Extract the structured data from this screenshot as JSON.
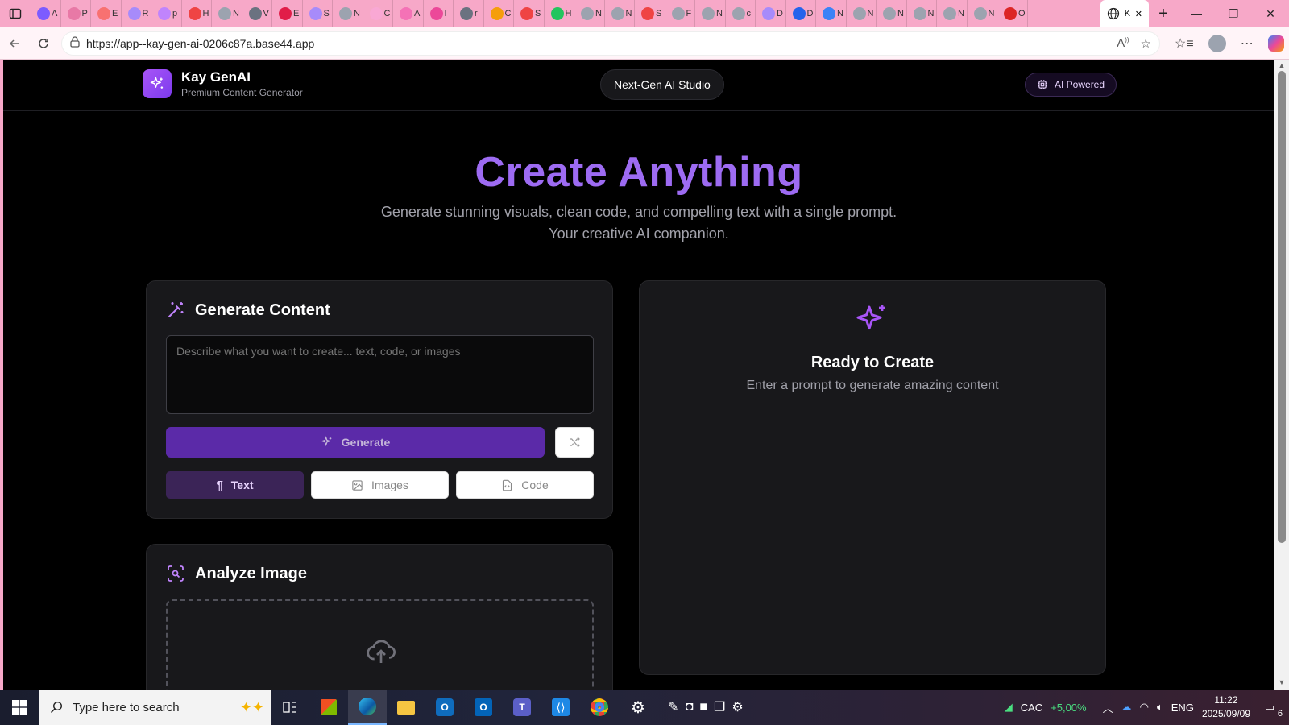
{
  "browser": {
    "url": "https://app--kay-gen-ai-0206c87a.base44.app",
    "tabs": [
      {
        "label": "A",
        "color": "#7c5cff"
      },
      {
        "label": "P",
        "color": "#e879a6"
      },
      {
        "label": "E",
        "color": "#f87171"
      },
      {
        "label": "R",
        "color": "#a78bfa"
      },
      {
        "label": "p",
        "color": "#c084fc"
      },
      {
        "label": "H",
        "color": "#ef4444"
      },
      {
        "label": "N",
        "color": "#9ca3af"
      },
      {
        "label": "V",
        "color": "#6b7280"
      },
      {
        "label": "E",
        "color": "#e11d48"
      },
      {
        "label": "S",
        "color": "#a78bfa"
      },
      {
        "label": "N",
        "color": "#9ca3af"
      },
      {
        "label": "C",
        "color": "#f9a8d4"
      },
      {
        "label": "A",
        "color": "#f472b6"
      },
      {
        "label": "I",
        "color": "#ec4899"
      },
      {
        "label": "r",
        "color": "#6b7280"
      },
      {
        "label": "C",
        "color": "#f59e0b"
      },
      {
        "label": "S",
        "color": "#ef4444"
      },
      {
        "label": "H",
        "color": "#22c55e"
      },
      {
        "label": "N",
        "color": "#9ca3af"
      },
      {
        "label": "N",
        "color": "#9ca3af"
      },
      {
        "label": "S",
        "color": "#ef4444"
      },
      {
        "label": "F",
        "color": "#9ca3af"
      },
      {
        "label": "N",
        "color": "#9ca3af"
      },
      {
        "label": "c",
        "color": "#9ca3af"
      },
      {
        "label": "D",
        "color": "#a78bfa"
      },
      {
        "label": "D",
        "color": "#2563eb"
      },
      {
        "label": "N",
        "color": "#3b82f6"
      },
      {
        "label": "N",
        "color": "#9ca3af"
      },
      {
        "label": "N",
        "color": "#9ca3af"
      },
      {
        "label": "N",
        "color": "#9ca3af"
      },
      {
        "label": "N",
        "color": "#9ca3af"
      },
      {
        "label": "N",
        "color": "#9ca3af"
      },
      {
        "label": "O",
        "color": "#dc2626"
      }
    ],
    "active_tab_label": "K"
  },
  "header": {
    "brand_title": "Kay GenAI",
    "brand_subtitle": "Premium Content Generator",
    "center_pill": "Next-Gen AI Studio",
    "badge": "AI Powered"
  },
  "hero": {
    "title": "Create Anything",
    "subtitle_line1": "Generate stunning visuals, clean code, and compelling text with a single prompt.",
    "subtitle_line2": "Your creative AI companion."
  },
  "generate_card": {
    "heading": "Generate Content",
    "prompt_placeholder": "Describe what you want to create... text, code, or images",
    "generate_label": "Generate",
    "types": [
      {
        "label": "Text",
        "active": true
      },
      {
        "label": "Images",
        "active": false
      },
      {
        "label": "Code",
        "active": false
      }
    ]
  },
  "analyze_card": {
    "heading": "Analyze Image"
  },
  "output_card": {
    "title": "Ready to Create",
    "subtitle": "Enter a prompt to generate amazing content"
  },
  "taskbar": {
    "search_placeholder": "Type here to search",
    "stock_name": "CAC",
    "stock_change": "+5,00%",
    "language": "ENG",
    "time": "11:22",
    "date": "2025/09/09",
    "notification_count": "6"
  },
  "colors": {
    "accent": "#9d6bf2",
    "generate_button": "#5b2aa8",
    "card_bg": "#18181b",
    "page_bg": "#000000",
    "browser_frame": "#f7a8c8"
  }
}
